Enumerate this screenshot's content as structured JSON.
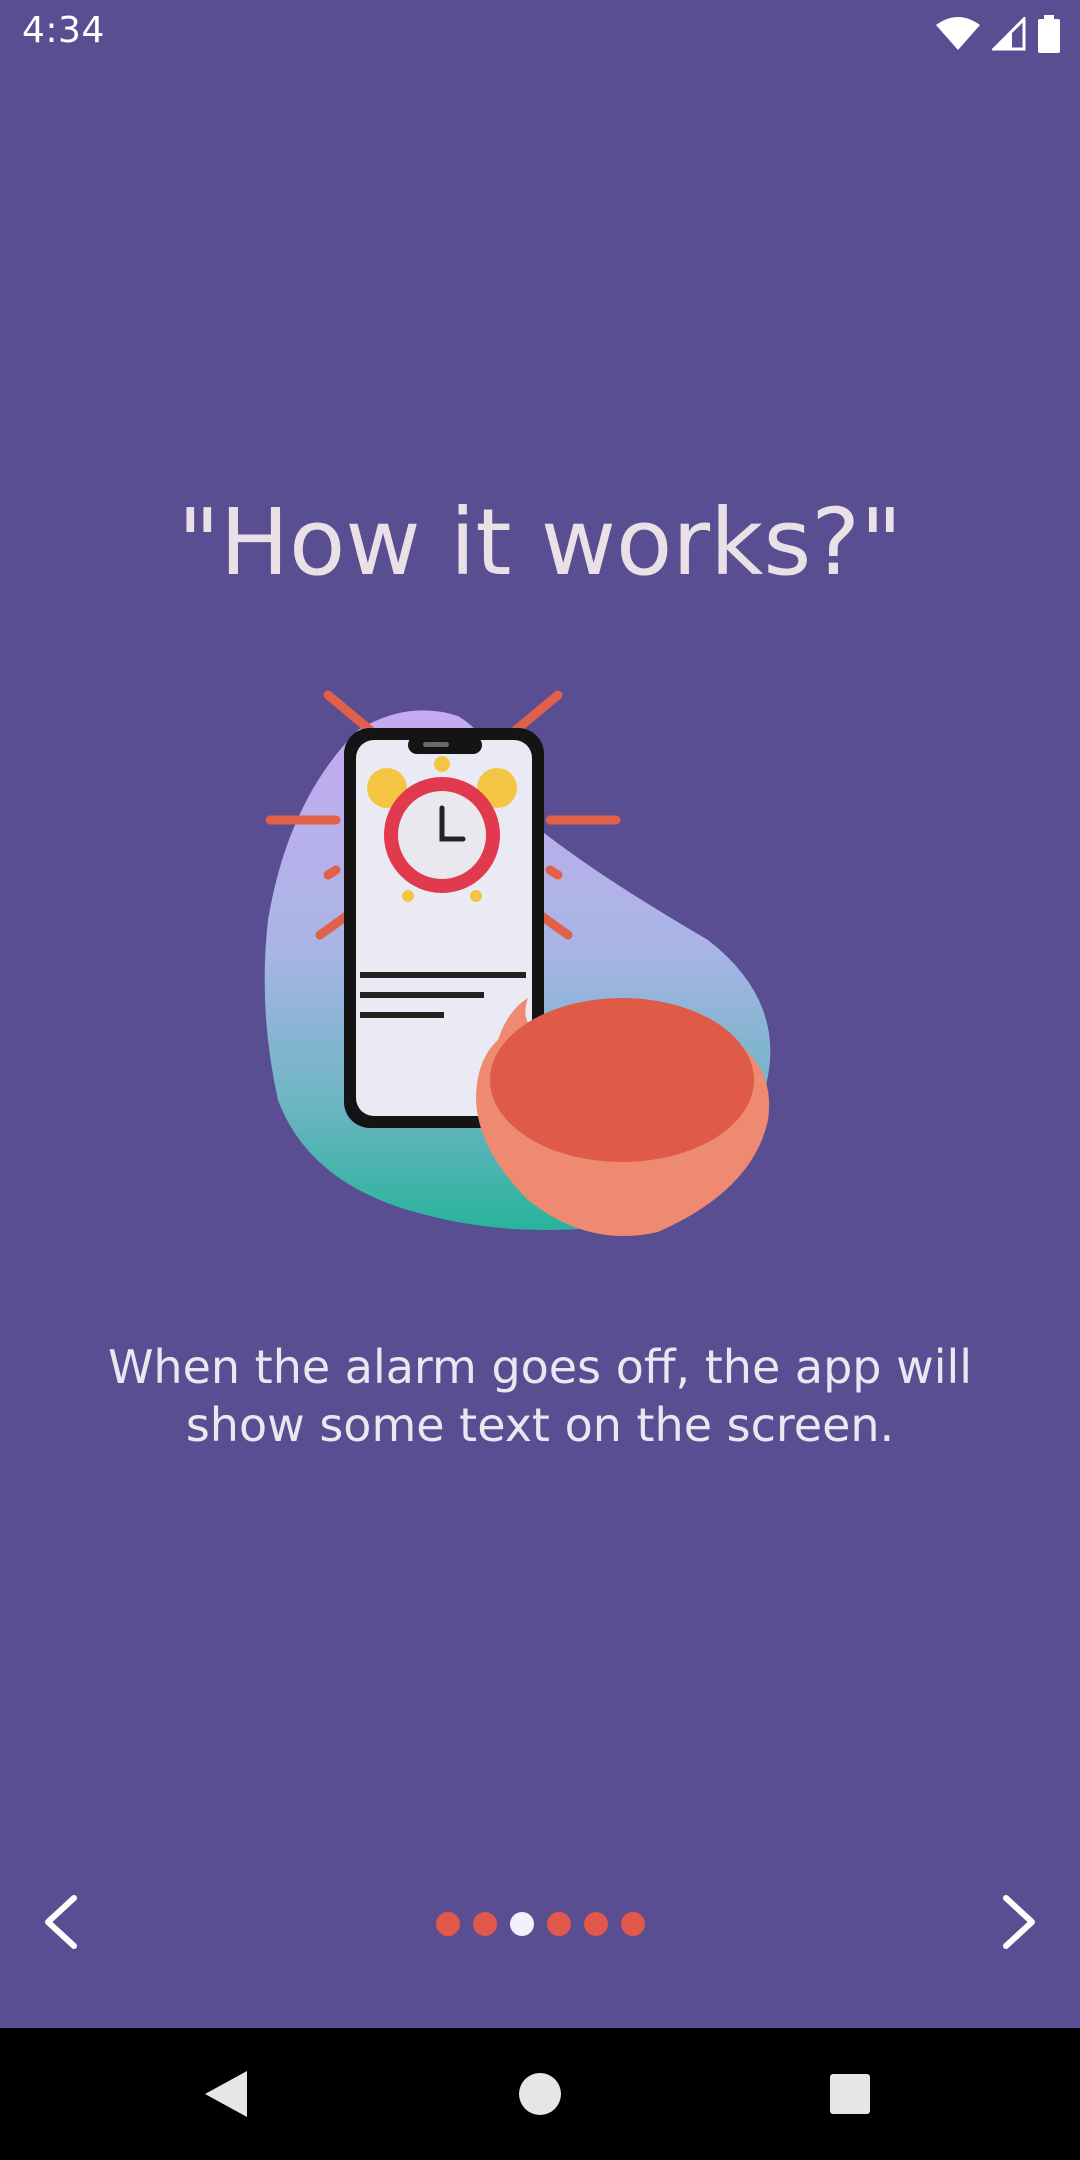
{
  "status_bar": {
    "time": "4:34",
    "icons": [
      "wifi-icon",
      "signal-icon",
      "battery-icon"
    ]
  },
  "onboarding": {
    "title": "\"How it works?\"",
    "description_line1": "When the alarm goes off, the app will",
    "description_line2": "show some text on the screen.",
    "illustration": "phone-alarm-illustration"
  },
  "pager": {
    "total_pages": 6,
    "current_page": 3,
    "prev_icon": "chevron-left-icon",
    "next_icon": "chevron-right-icon"
  },
  "system_nav": {
    "buttons": [
      "back-icon",
      "home-icon",
      "recents-icon"
    ]
  },
  "colors": {
    "background": "#594e91",
    "accent": "#e2584a",
    "title_text": "#e9e1e6",
    "active_dot": "#f3f0fb"
  }
}
